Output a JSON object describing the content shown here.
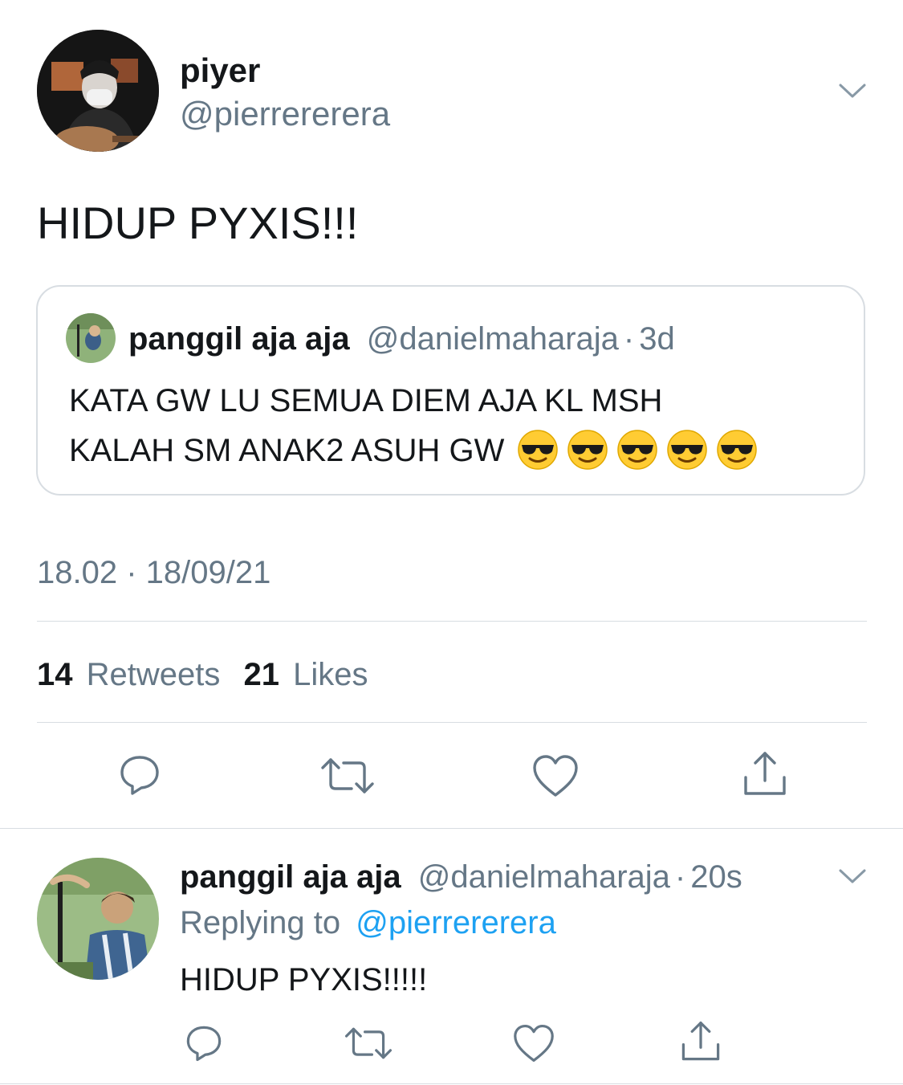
{
  "main_tweet": {
    "display_name": "piyer",
    "handle": "@pierrererera",
    "text": "HIDUP PYXIS!!!",
    "timestamp": "18.02 · 18/09/21",
    "retweet_count": "14",
    "retweet_label": "Retweets",
    "like_count": "21",
    "like_label": "Likes"
  },
  "quoted_tweet": {
    "display_name": "panggil aja aja",
    "handle": "@danielmaharaja",
    "separator": "·",
    "time": "3d",
    "text_line1": "KATA GW LU SEMUA DIEM AJA KL MSH",
    "text_line2": "KALAH SM ANAK2 ASUH GW",
    "emoji_count": 5
  },
  "reply_tweet": {
    "display_name": "panggil aja aja",
    "handle": "@danielmaharaja",
    "separator": "·",
    "time": "20s",
    "replying_label": "Replying to",
    "replying_handle": "@pierrererera",
    "text": "HIDUP PYXIS!!!!!"
  },
  "icons": {
    "reply": "speech-bubble-icon",
    "retweet": "retweet-arrows-icon",
    "like": "heart-outline-icon",
    "share": "share-upload-icon",
    "more": "chevron-down-icon",
    "emoji": "sunglasses-face-emoji"
  },
  "colors": {
    "text": "#14171a",
    "secondary": "#657786",
    "link": "#1da1f2",
    "divider": "#d8dde2"
  }
}
